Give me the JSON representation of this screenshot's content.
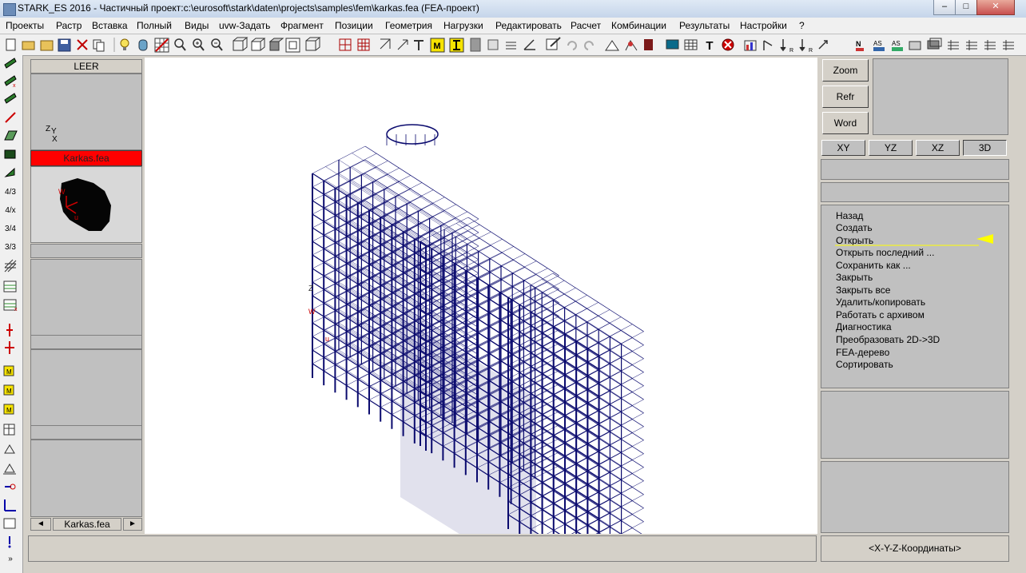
{
  "window": {
    "title": "STARK_ES 2016 - Частичный проект:c:\\eurosoft\\stark\\daten\\projects\\samples\\fem\\karkas.fea  (FEA-проект)",
    "min_label": "–",
    "max_label": "□",
    "close_label": "✕"
  },
  "menu": {
    "items": [
      "Проекты",
      "Растр",
      "Вставка",
      "Полный",
      "Виды",
      "uvw-Задать",
      "Фрагмент",
      "Позиции",
      "Геометрия",
      "Нагрузки",
      "Редактировать",
      "Расчет",
      "Комбинации",
      "Результаты",
      "Настройки",
      "?"
    ]
  },
  "left_panel": {
    "header": "LEER",
    "axis_label_z": "Z",
    "axis_label_y": "Y",
    "axis_label_x": "X",
    "active_file": "Karkas.fea",
    "thumb_label_w": "W",
    "thumb_label_u": "u",
    "nav_file": "Karkas.fea",
    "nav_prev": "◄",
    "nav_next": "►"
  },
  "vertical_toolbar": {
    "labels": [
      "4/3",
      "4/x",
      "3/4",
      "3/3"
    ],
    "more": "»"
  },
  "right_panel": {
    "buttons": [
      "Zoom",
      "Refr",
      "Word"
    ],
    "views": [
      "XY",
      "YZ",
      "XZ",
      "3D"
    ],
    "active_view": "3D",
    "menu_items": [
      "Назад",
      "Создать",
      "Открыть",
      "Открыть последний ...",
      "Сохранить как ...",
      "Закрыть",
      "Закрыть все",
      "Удалить/копировать",
      "Работать с архивом",
      "Диагностика",
      "Преобразовать 2D->3D",
      "FEA-дерево",
      "Сортировать"
    ],
    "highlighted_item": "Открыть",
    "coords_label": "<X-Y-Z-Координаты>"
  },
  "model": {
    "line_color": "#0a0a6e",
    "axis_label_z": "Z",
    "axis_label_w": "W",
    "axis_label_u": "u"
  },
  "colors": {
    "active_file_bg": "#ff0000",
    "highlight_arrow": "#ffff00",
    "model_lines": "#0a0a6e"
  }
}
